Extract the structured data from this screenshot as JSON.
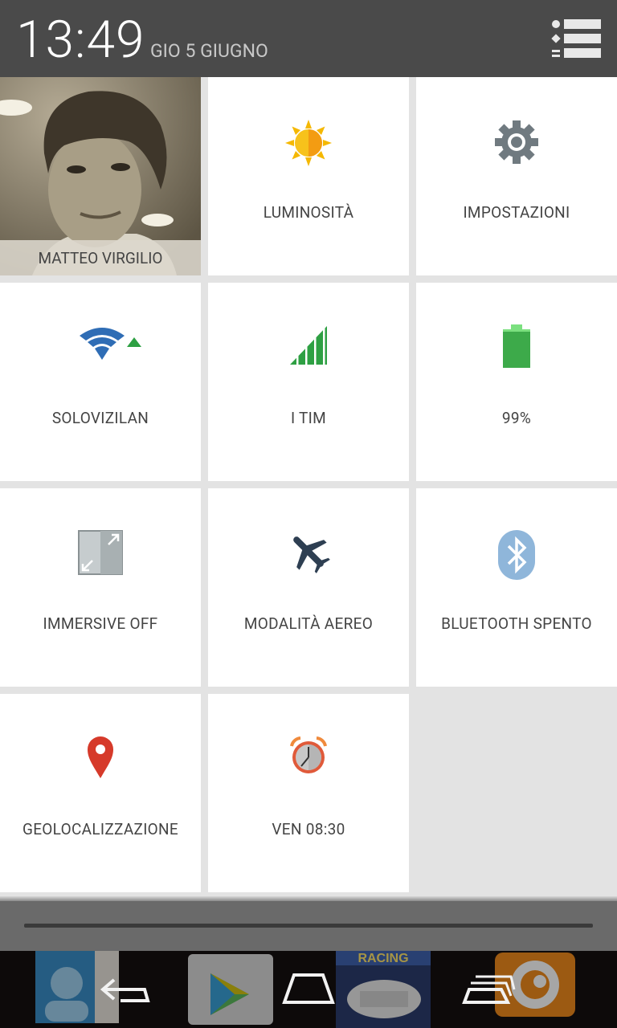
{
  "status": {
    "time": "13:49",
    "date": "GIO 5 GIUGNO"
  },
  "user": {
    "name": "MATTEO VIRGILIO"
  },
  "tiles": [
    {
      "label": "LUMINOSITÀ",
      "icon": "sun-icon"
    },
    {
      "label": "IMPOSTAZIONI",
      "icon": "gear-icon"
    },
    {
      "label": "SOLOVIZILAN",
      "icon": "wifi-icon"
    },
    {
      "label": "I TIM",
      "icon": "signal-icon"
    },
    {
      "label": "99%",
      "icon": "battery-icon"
    },
    {
      "label": "IMMERSIVE OFF",
      "icon": "immersive-icon"
    },
    {
      "label": "MODALITÀ AEREO",
      "icon": "airplane-icon"
    },
    {
      "label": "BLUETOOTH SPENTO",
      "icon": "bluetooth-icon"
    },
    {
      "label": "GEOLOCALIZZAZIONE",
      "icon": "location-pin-icon"
    },
    {
      "label": "VEN 08:30",
      "icon": "alarm-clock-icon"
    }
  ],
  "colors": {
    "header_bg": "#4a4a4a",
    "grid_bg": "#e3e3e3",
    "tile_bg": "#ffffff",
    "wifi": "#2f6db5",
    "signal": "#2ea043",
    "battery": "#3daa4a",
    "alarm": "#e05a3a",
    "pin": "#d63a2a"
  },
  "navbar": {
    "buttons": [
      "back-icon",
      "home-icon",
      "recent-apps-icon"
    ],
    "background_apps": [
      "contacts-app-icon",
      "play-store-app-icon",
      "racing-game-app-icon",
      "swirl-app-icon"
    ],
    "racing_app_text": "RACING"
  },
  "battery_level": 0.99
}
